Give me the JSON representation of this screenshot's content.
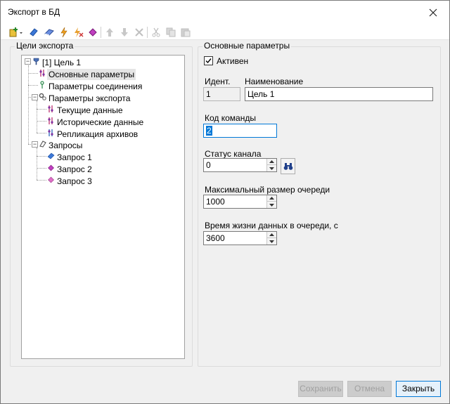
{
  "window": {
    "title": "Экспорт в БД"
  },
  "toolbar": {
    "icons": [
      "new-target-icon",
      "add-query-blue-icon",
      "add-query-eraser-icon",
      "lightning-icon",
      "lightning-x-icon",
      "purple-gem-icon",
      "move-up-icon",
      "move-down-icon",
      "delete-icon",
      "cut-icon",
      "copy-icon",
      "paste-icon"
    ]
  },
  "left_panel": {
    "group_label": "Цели экспорта"
  },
  "tree": {
    "root": "[1] Цель 1",
    "main_params": "Основные параметры",
    "connection_params": "Параметры соединения",
    "export_params": "Параметры экспорта",
    "current_data": "Текущие данные",
    "historical_data": "Исторические данные",
    "archive_replication": "Репликация архивов",
    "queries": "Запросы",
    "query1": "Запрос 1",
    "query2": "Запрос 2",
    "query3": "Запрос 3"
  },
  "right_panel": {
    "group_label": "Основные параметры",
    "active_label": "Активен",
    "active_checked": true,
    "id_label": "Идент.",
    "id_value": "1",
    "name_label": "Наименование",
    "name_value": "Цель 1",
    "command_code_label": "Код команды",
    "command_code_value": "2",
    "channel_status_label": "Статус канала",
    "channel_status_value": "0",
    "max_queue_label": "Максимальный размер очереди",
    "max_queue_value": "1000",
    "queue_ttl_label": "Время жизни данных в очереди, с",
    "queue_ttl_value": "3600"
  },
  "buttons": {
    "save": "Сохранить",
    "cancel": "Отмена",
    "close": "Закрыть"
  },
  "colors": {
    "accent": "#0078d7",
    "window_bg": "#f0f0f0",
    "selection": "#e5e5e5"
  }
}
